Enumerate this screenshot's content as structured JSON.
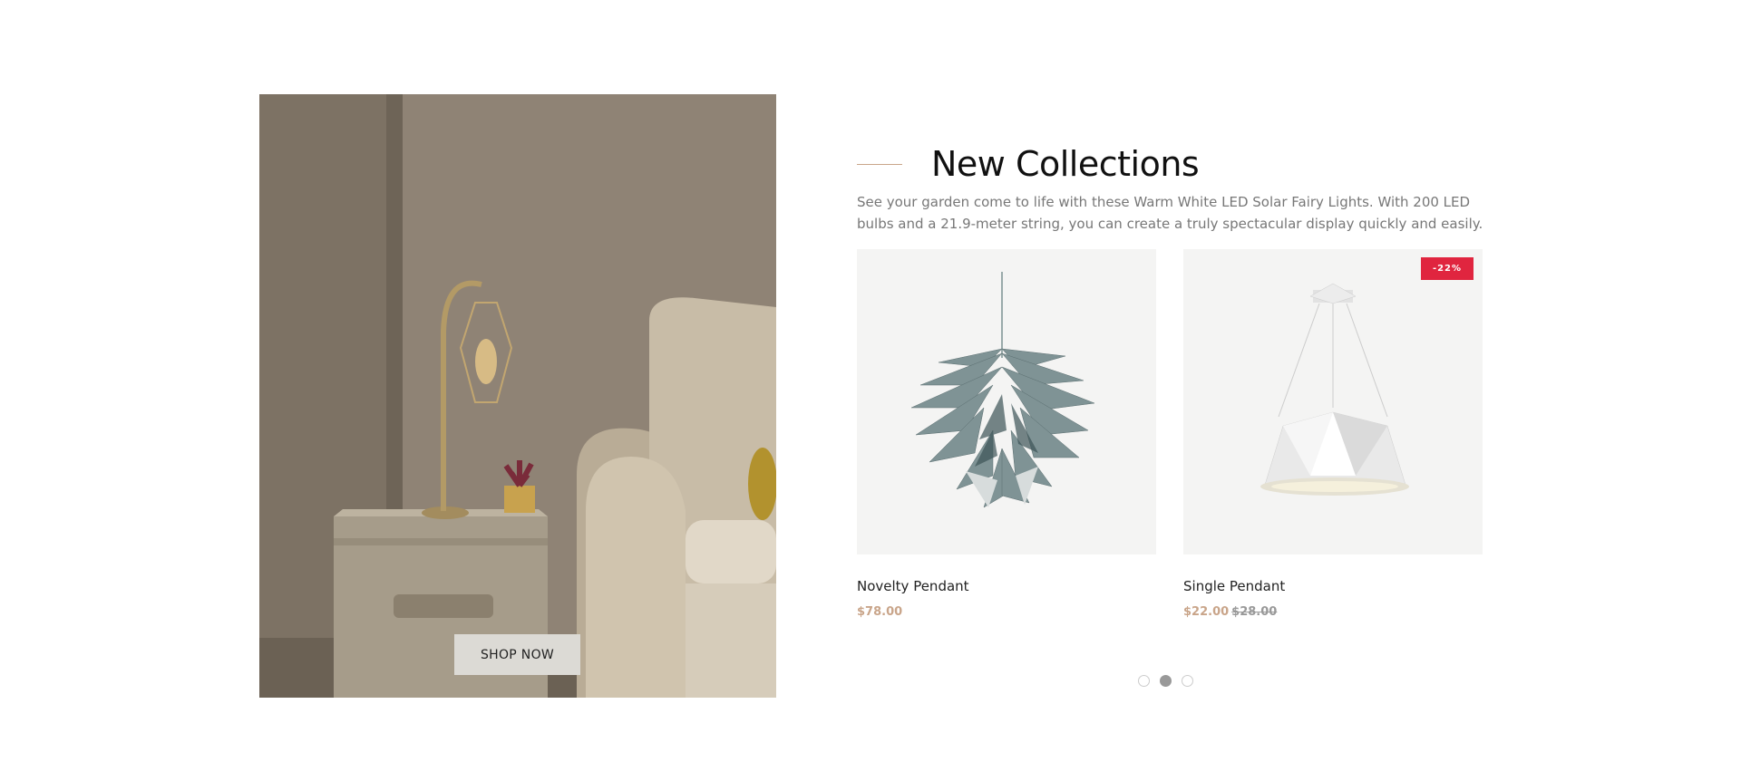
{
  "banner": {
    "button_label": "SHOP NOW"
  },
  "section": {
    "title": "New Collections",
    "description": "See your garden come to life with these Warm White LED Solar Fairy Lights. With 200 LED bulbs and a 21.9-meter string, you can create a truly spectacular display quickly and easily."
  },
  "products": [
    {
      "name": "Novelty Pendant",
      "price": "$78.00",
      "old_price": "",
      "badge": ""
    },
    {
      "name": "Single Pendant",
      "price": "$22.00",
      "old_price": "$28.00",
      "badge": "-22%"
    }
  ],
  "carousel": {
    "dots": 3,
    "active_index": 1
  },
  "colors": {
    "accent": "#c9a58a",
    "badge": "#e0253f"
  }
}
